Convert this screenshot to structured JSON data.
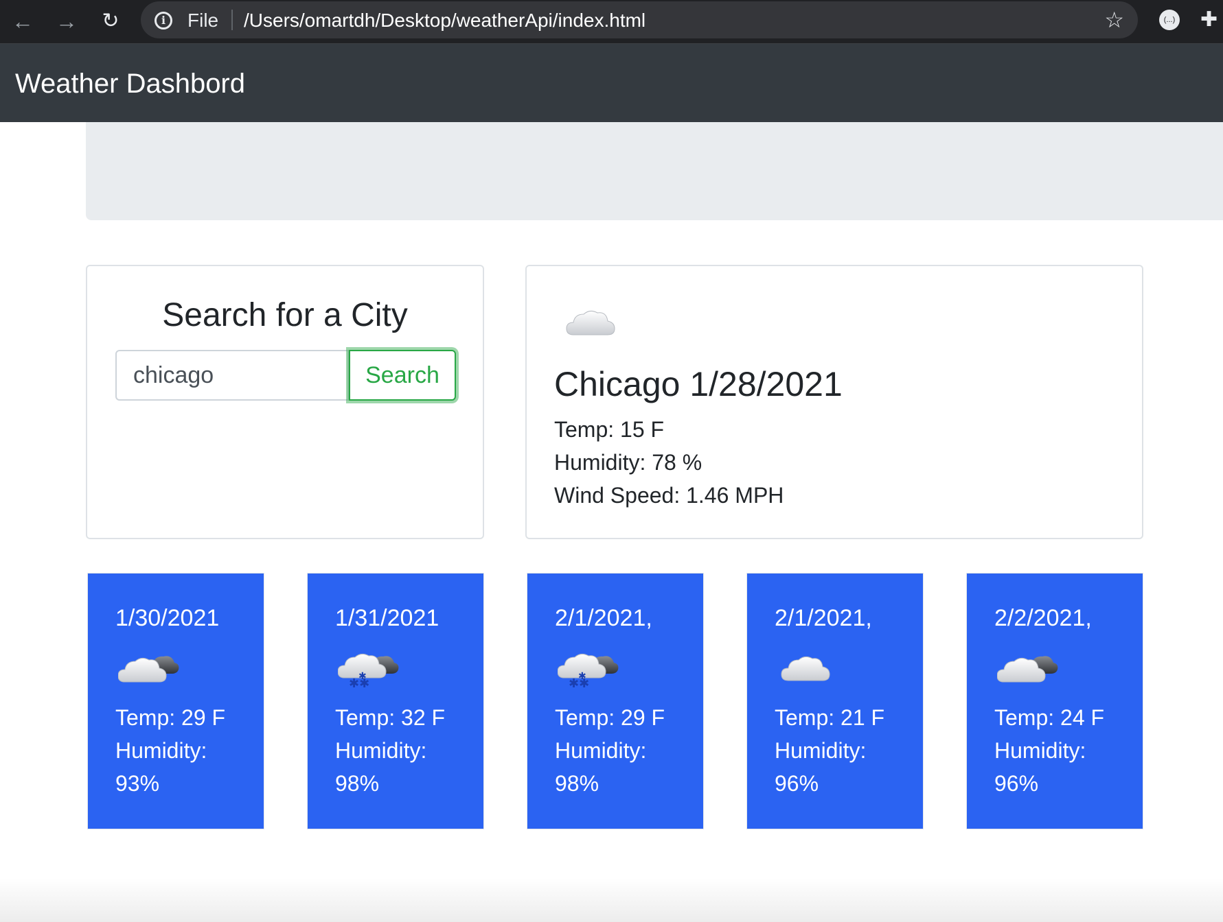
{
  "browser": {
    "scheme": "File",
    "url": "/Users/omartdh/Desktop/weatherApi/index.html",
    "icons": [
      "back-arrow-icon",
      "forward-arrow-icon",
      "reload-icon",
      "info-icon",
      "star-icon",
      "extension-icon",
      "puzzle-icon"
    ]
  },
  "navbar": {
    "brand": "Weather Dashbord"
  },
  "search": {
    "title": "Search for a City",
    "input_value": "chicago",
    "button_label": "Search"
  },
  "current": {
    "icon": "cloud-icon",
    "title": "Chicago 1/28/2021",
    "temp": "Temp: 15 F",
    "humidity": "Humidity: 78 %",
    "wind": "Wind Speed: 1.46 MPH"
  },
  "forecast": [
    {
      "date": "1/30/2021",
      "icon": "partly-cloudy-icon",
      "temp": "Temp: 29 F",
      "humidity_label": "Humidity:",
      "humidity_value": "93%"
    },
    {
      "date": "1/31/2021",
      "icon": "snow-cloud-icon",
      "temp": "Temp: 32 F",
      "humidity_label": "Humidity:",
      "humidity_value": "98%"
    },
    {
      "date": "2/1/2021,",
      "icon": "snow-cloud-icon",
      "temp": "Temp: 29 F",
      "humidity_label": "Humidity:",
      "humidity_value": "98%"
    },
    {
      "date": "2/1/2021,",
      "icon": "cloud-icon",
      "temp": "Temp: 21 F",
      "humidity_label": "Humidity:",
      "humidity_value": "96%"
    },
    {
      "date": "2/2/2021,",
      "icon": "partly-cloudy-icon",
      "temp": "Temp: 24 F",
      "humidity_label": "Humidity:",
      "humidity_value": "96%"
    }
  ],
  "colors": {
    "navbar": "#343a40",
    "jumbotron": "#e9ecef",
    "forecast_card": "#2b63f2",
    "search_button": "#28a745"
  }
}
